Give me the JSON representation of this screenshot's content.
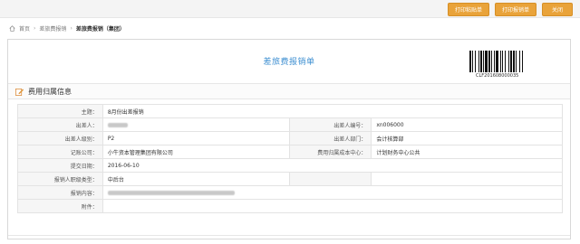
{
  "toolbar": {
    "print_paste_label": "打印粘贴单",
    "print_form_label": "打印报销单",
    "close_label": "关闭"
  },
  "breadcrumb": {
    "home": "首页",
    "level1": "差旅费报销",
    "current": "差旅费报销（集团）",
    "sep": "›"
  },
  "sheet": {
    "title": "差旅费报销单",
    "barcode_number": "CLF201608000035"
  },
  "section": {
    "title": "费用归属信息"
  },
  "form": {
    "subject_label": "主题：",
    "subject_value": "8月份出差报销",
    "traveler_label": "出差人：",
    "traveler_no_label": "出差人编号：",
    "traveler_no_value": "xn006000",
    "level_label": "出差人级别：",
    "level_value": "P2",
    "dept_label": "出差人部门：",
    "dept_value": "会计核算部",
    "company_label": "记账公司：",
    "company_value": "小牛资本管理集团有限公司",
    "cost_center_label": "费用归属成本中心：",
    "cost_center_value": "计划财务中心公共",
    "date_label": "提交日期：",
    "date_value": "2016-06-10",
    "person_type_label": "报销人职级类型：",
    "person_type_value": "中后台",
    "content_label": "报销内容：",
    "attachment_label": "附件："
  },
  "colors": {
    "accent_button": "#e9a33a",
    "title_blue": "#3e8fd1"
  },
  "icons": {
    "section_icon": "pencil-icon",
    "home_icon": "home-icon"
  }
}
